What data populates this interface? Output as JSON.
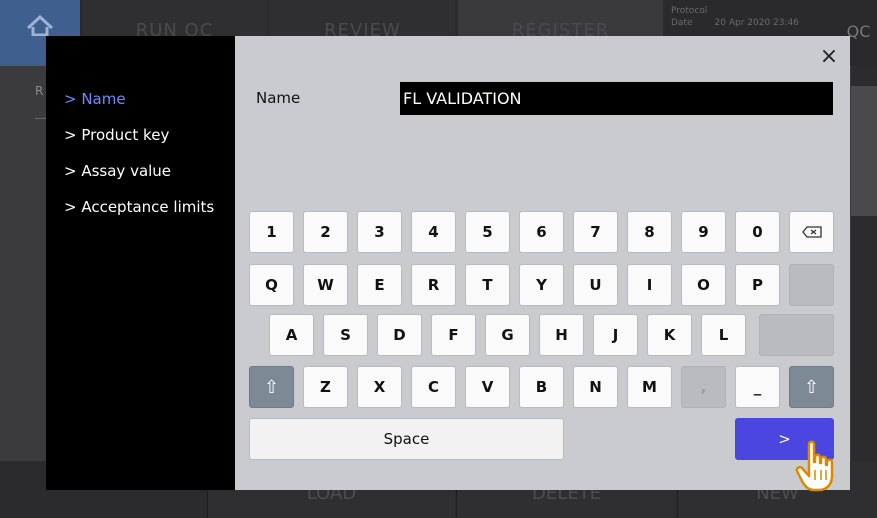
{
  "background": {
    "tabs": {
      "run": "RUN QC",
      "review": "REVIEW",
      "register": "REGISTER"
    },
    "protocol": {
      "label": "Protocol",
      "date_label": "Date",
      "date_value": "20 Apr 2020 23:46"
    },
    "qc": "QC",
    "r_letter": "R",
    "bottom": {
      "load": "LOAD",
      "delete": "DELETE",
      "new": "NEW"
    }
  },
  "sidebar": {
    "items": [
      {
        "label": "> Name",
        "active": true
      },
      {
        "label": "> Product key",
        "active": false
      },
      {
        "label": "> Assay value",
        "active": false
      },
      {
        "label": "> Acceptance limits",
        "active": false
      }
    ]
  },
  "dialog": {
    "close": "×",
    "field_label": "Name",
    "field_value": "FL VALIDATION"
  },
  "keyboard": {
    "row1": [
      "1",
      "2",
      "3",
      "4",
      "5",
      "6",
      "7",
      "8",
      "9",
      "0"
    ],
    "row2": [
      "Q",
      "W",
      "E",
      "R",
      "T",
      "Y",
      "U",
      "I",
      "O",
      "P"
    ],
    "row3": [
      "A",
      "S",
      "D",
      "F",
      "G",
      "H",
      "J",
      "K",
      "L"
    ],
    "row4": [
      "Z",
      "X",
      "C",
      "V",
      "B",
      "N",
      "M",
      ",",
      "_"
    ],
    "shift": "⇧",
    "space": "Space",
    "next": ">"
  },
  "colors": {
    "active_item": "#6b8cff",
    "next_button": "#4b46e0",
    "shift_key": "#7d8a96"
  }
}
